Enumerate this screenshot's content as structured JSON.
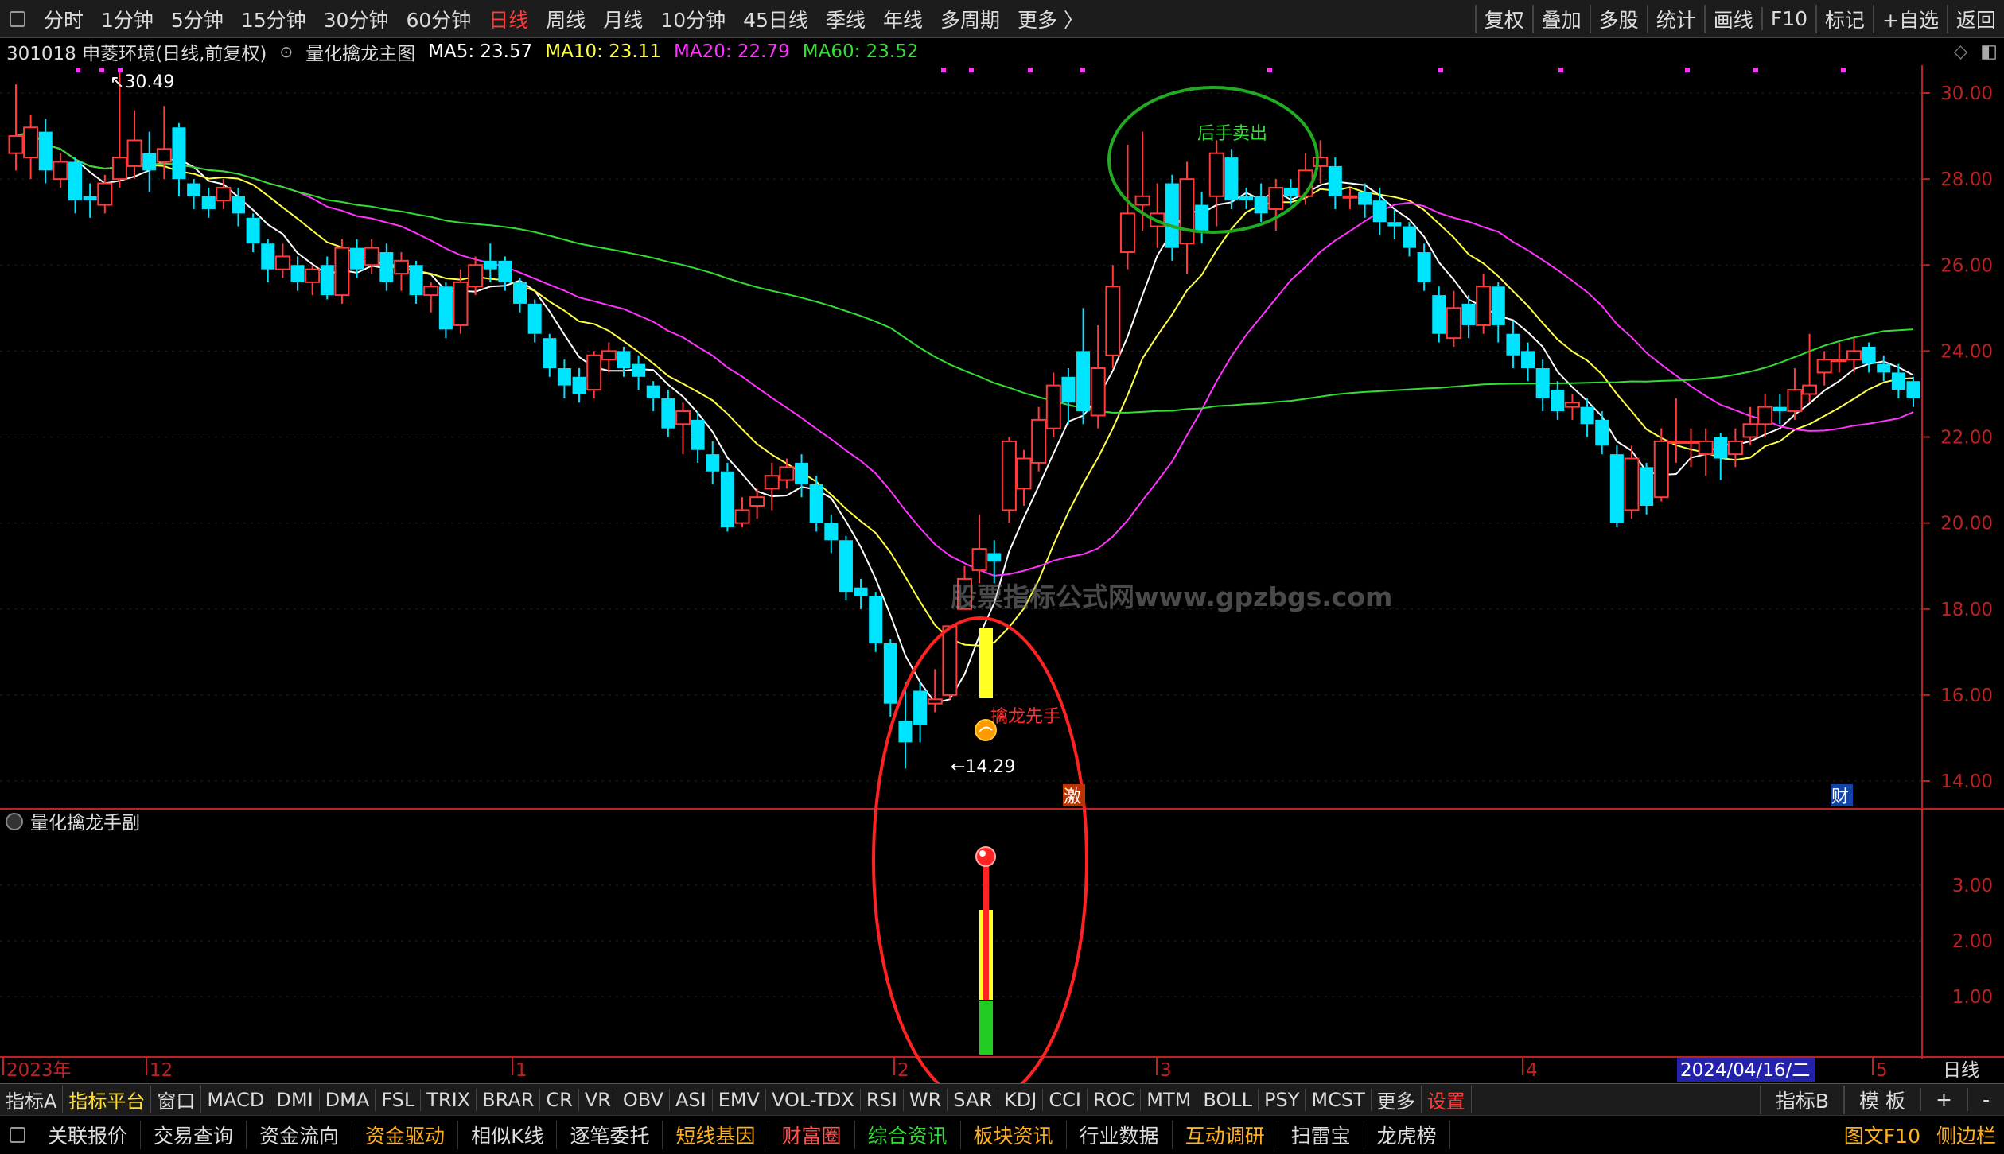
{
  "toolbar": {
    "periods": [
      "分时",
      "1分钟",
      "5分钟",
      "15分钟",
      "30分钟",
      "60分钟",
      "日线",
      "周线",
      "月线",
      "10分钟",
      "45日线",
      "季线",
      "年线",
      "多周期",
      "更多 〉"
    ],
    "active": "日线",
    "right": [
      "复权",
      "叠加",
      "多股",
      "统计",
      "画线",
      "F10",
      "标记",
      "+自选",
      "返回"
    ]
  },
  "info": {
    "stock": "301018 申菱环境(日线,前复权)",
    "indicator": "量化擒龙主图",
    "ma5": "MA5: 23.57",
    "ma10": "MA10: 23.11",
    "ma20": "MA20: 22.79",
    "ma60": "MA60: 23.52"
  },
  "colors": {
    "up": "#ff3b3b",
    "down": "#00e5ff",
    "ma5": "#ffffff",
    "ma10": "#ffff44",
    "ma20": "#ff33ff",
    "ma60": "#33dd33",
    "axis": "#bb2222"
  },
  "price_axis": [
    "30.00",
    "28.00",
    "26.00",
    "24.00",
    "22.00",
    "20.00",
    "18.00",
    "16.00",
    "14.00"
  ],
  "sub_axis": [
    "3.00",
    "2.00",
    "1.00"
  ],
  "annotations": {
    "high": "30.49",
    "low": "←14.29",
    "sell": "后手卖出",
    "buy": "擒龙先手",
    "watermark": "股票指标公式网www.gpzbgs.com",
    "ji": "激",
    "cai": "财"
  },
  "sub_title": "量化擒龙手副",
  "x_axis": {
    "labels": [
      "2023年",
      "12",
      "1",
      "2",
      "3",
      "4",
      "5"
    ],
    "current": "2024/04/16/二",
    "period": "日线"
  },
  "indicator_tabs": [
    "指标A",
    "指标平台",
    "窗口",
    "MACD",
    "DMI",
    "DMA",
    "FSL",
    "TRIX",
    "BRAR",
    "CR",
    "VR",
    "OBV",
    "ASI",
    "EMV",
    "VOL-TDX",
    "RSI",
    "WR",
    "SAR",
    "KDJ",
    "CCI",
    "ROC",
    "MTM",
    "BOLL",
    "PSY",
    "MCST",
    "更多",
    "设置"
  ],
  "indicator_right": [
    "指标B",
    "模 板",
    "+",
    "-"
  ],
  "nav": [
    {
      "label": "关联报价",
      "style": ""
    },
    {
      "label": "交易查询",
      "style": ""
    },
    {
      "label": "资金流向",
      "style": ""
    },
    {
      "label": "资金驱动",
      "style": "orange"
    },
    {
      "label": "相似K线",
      "style": ""
    },
    {
      "label": "逐笔委托",
      "style": ""
    },
    {
      "label": "短线基因",
      "style": "orange"
    },
    {
      "label": "财富圈",
      "style": "red"
    },
    {
      "label": "综合资讯",
      "style": "green"
    },
    {
      "label": "板块资讯",
      "style": "orange"
    },
    {
      "label": "行业数据",
      "style": ""
    },
    {
      "label": "互动调研",
      "style": "orange"
    },
    {
      "label": "扫雷宝",
      "style": ""
    },
    {
      "label": "龙虎榜",
      "style": ""
    }
  ],
  "nav_right": [
    "图文F10",
    "侧边栏"
  ]
}
